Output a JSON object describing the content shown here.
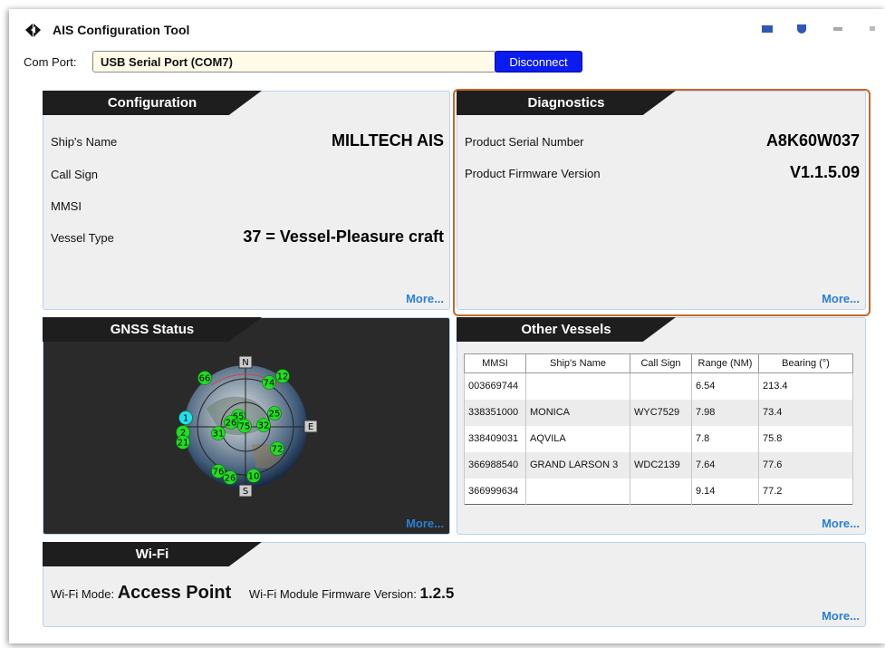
{
  "app": {
    "title": "AIS Configuration Tool"
  },
  "connection": {
    "com_port_label": "Com Port:",
    "com_port_value": "USB Serial Port (COM7)",
    "disconnect_label": "Disconnect"
  },
  "configuration": {
    "header": "Configuration",
    "ships_name_label": "Ship's Name",
    "ships_name_value": "MILLTECH AIS",
    "call_sign_label": "Call Sign",
    "call_sign_value": "",
    "mmsi_label": "MMSI",
    "mmsi_value": "",
    "vessel_type_label": "Vessel Type",
    "vessel_type_value": "37 = Vessel-Pleasure craft",
    "more_label": "More..."
  },
  "diagnostics": {
    "header": "Diagnostics",
    "serial_label": "Product Serial Number",
    "serial_value": "A8K60W037",
    "firmware_label": "Product Firmware Version",
    "firmware_value": "V1.1.5.09",
    "more_label": "More..."
  },
  "gnss": {
    "header": "GNSS Status",
    "compass": {
      "north": "N",
      "east": "E",
      "south": "S"
    },
    "satellites": [
      "66",
      "74",
      "12",
      "1",
      "65",
      "26",
      "75",
      "32",
      "25",
      "2",
      "31",
      "21",
      "72",
      "76",
      "26",
      "10"
    ],
    "more_label": "More..."
  },
  "other_vessels": {
    "header": "Other Vessels",
    "columns": [
      "MMSI",
      "Ship's Name",
      "Call Sign",
      "Range (NM)",
      "Bearing (°)"
    ],
    "rows": [
      [
        "003669744",
        "",
        "",
        "6.54",
        "213.4"
      ],
      [
        "338351000",
        "MONICA",
        "WYC7529",
        "7.98",
        "73.4"
      ],
      [
        "338409031",
        "AQVILA",
        "",
        "7.8",
        "75.8"
      ],
      [
        "366988540",
        "GRAND LARSON 3",
        "WDC2139",
        "7.64",
        "77.6"
      ],
      [
        "366999634",
        "",
        "",
        "9.14",
        "77.2"
      ]
    ],
    "more_label": "More..."
  },
  "wifi": {
    "header": "Wi-Fi",
    "mode_label": "Wi-Fi Mode:",
    "mode_value": "Access Point",
    "fw_label": "Wi-Fi  Module Firmware Version:",
    "fw_value": "1.2.5",
    "more_label": "More..."
  },
  "icons": {
    "app": "ais-logo-icon",
    "ctrl1": "minimize-icon",
    "ctrl2": "shield-icon",
    "ctrl3": "restore-icon",
    "ctrl4": "pin-icon"
  },
  "colors": {
    "accent": "#0a1cf0",
    "link": "#2a7fd4",
    "highlight": "#c8662a",
    "satellite_green": "#22dd22",
    "satellite_cyan": "#22e0f0"
  }
}
